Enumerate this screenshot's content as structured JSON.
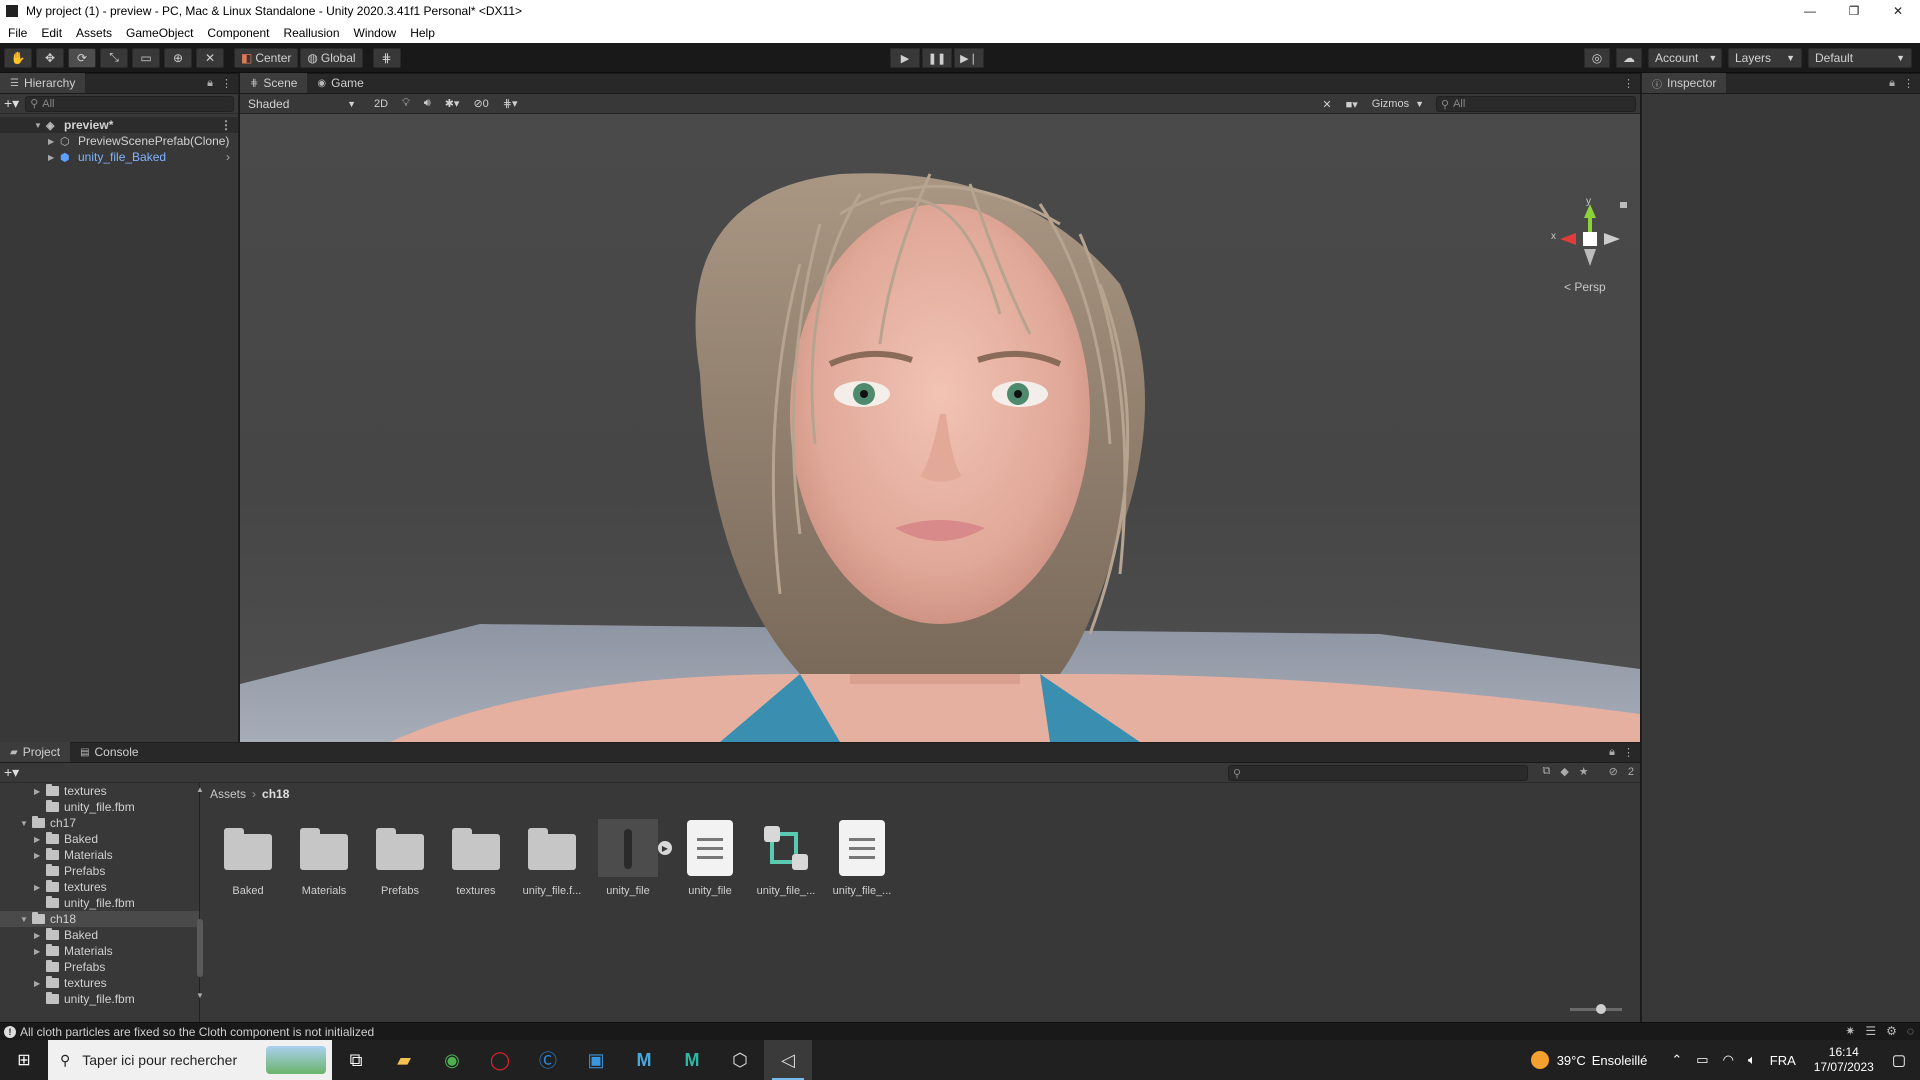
{
  "window": {
    "title": "My project (1) - preview - PC, Mac & Linux Standalone - Unity 2020.3.41f1 Personal* <DX11>",
    "controls": [
      "—",
      "❐",
      "✕"
    ]
  },
  "menubar": [
    "File",
    "Edit",
    "Assets",
    "GameObject",
    "Component",
    "Reallusion",
    "Window",
    "Help"
  ],
  "toolbar": {
    "pivot_mode": "Center",
    "pivot_rotation": "Global",
    "account_label": "Account",
    "layers_label": "Layers",
    "layout_label": "Default"
  },
  "hierarchy": {
    "tab_label": "Hierarchy",
    "search_placeholder": "All",
    "scene_name": "preview*",
    "items": [
      {
        "label": "PreviewScenePrefab(Clone)"
      },
      {
        "label": "unity_file_Baked"
      }
    ]
  },
  "scene": {
    "tabs": [
      "Scene",
      "Game"
    ],
    "shading_mode": "Shaded",
    "mode_2d": "2D",
    "hidden_count": "0",
    "gizmos_label": "Gizmos",
    "search_placeholder": "All",
    "axis_y": "y",
    "axis_x": "x",
    "projection": "< Persp"
  },
  "inspector": {
    "tab_label": "Inspector"
  },
  "project": {
    "tabs": [
      "Project",
      "Console"
    ],
    "hidden_count": "2",
    "tree": [
      {
        "label": "textures",
        "depth": 2,
        "expandable": true
      },
      {
        "label": "unity_file.fbm",
        "depth": 2,
        "expandable": false
      },
      {
        "label": "ch17",
        "depth": 1,
        "expandable": true
      },
      {
        "label": "Baked",
        "depth": 2,
        "expandable": true
      },
      {
        "label": "Materials",
        "depth": 2,
        "expandable": true
      },
      {
        "label": "Prefabs",
        "depth": 2,
        "expandable": false
      },
      {
        "label": "textures",
        "depth": 2,
        "expandable": true
      },
      {
        "label": "unity_file.fbm",
        "depth": 2,
        "expandable": false
      },
      {
        "label": "ch18",
        "depth": 1,
        "expandable": true,
        "selected": true
      },
      {
        "label": "Baked",
        "depth": 2,
        "expandable": true
      },
      {
        "label": "Materials",
        "depth": 2,
        "expandable": true
      },
      {
        "label": "Prefabs",
        "depth": 2,
        "expandable": false
      },
      {
        "label": "textures",
        "depth": 2,
        "expandable": true
      },
      {
        "label": "unity_file.fbm",
        "depth": 2,
        "expandable": false
      }
    ],
    "breadcrumb": {
      "root": "Assets",
      "current": "ch18"
    },
    "assets": [
      {
        "label": "Baked",
        "kind": "folder"
      },
      {
        "label": "Materials",
        "kind": "folder"
      },
      {
        "label": "Prefabs",
        "kind": "folder"
      },
      {
        "label": "textures",
        "kind": "folder"
      },
      {
        "label": "unity_file.f...",
        "kind": "folder"
      },
      {
        "label": "unity_file",
        "kind": "model"
      },
      {
        "label": "unity_file",
        "kind": "document"
      },
      {
        "label": "unity_file_...",
        "kind": "prefab-link"
      },
      {
        "label": "unity_file_...",
        "kind": "document"
      }
    ]
  },
  "status": {
    "message": "All cloth particles are fixed so the Cloth component is not initialized"
  },
  "taskbar": {
    "search_placeholder": "Taper ici pour rechercher",
    "weather_temp": "39°C",
    "weather_desc": "Ensoleillé",
    "language": "FRA",
    "time": "16:14",
    "date": "17/07/2023"
  },
  "colors": {
    "editor_bg": "#383838",
    "viewport_bg": "#464646",
    "accent_blue": "#7fb3ff",
    "gizmo_x": "#e23b3b",
    "gizmo_y": "#8ed23a"
  }
}
